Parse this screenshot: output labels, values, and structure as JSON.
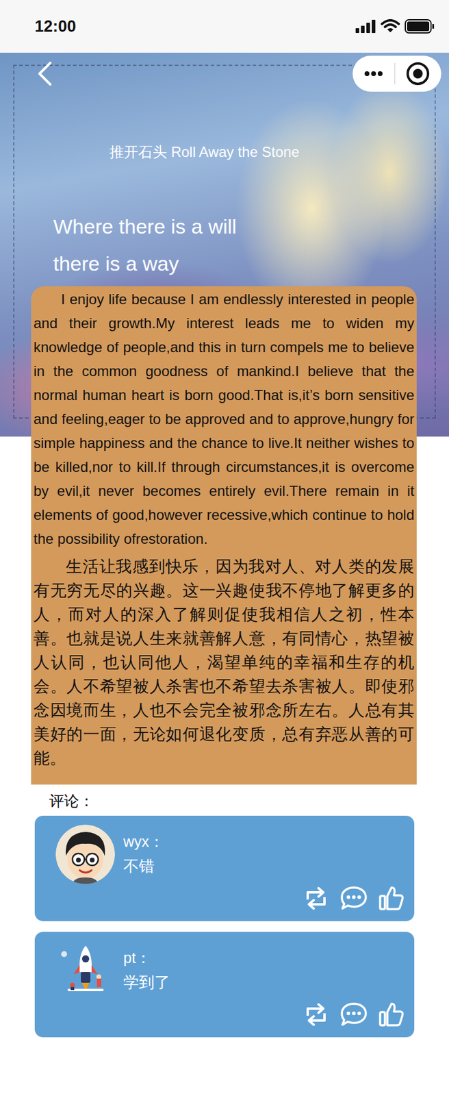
{
  "status_bar": {
    "time": "12:00"
  },
  "hero": {
    "subtitle": "推开石头 Roll Away the Stone",
    "slogan": [
      "Where there is a will",
      "there is a way"
    ]
  },
  "article": {
    "paragraphs": [
      {
        "lang": "en",
        "text": "I enjoy life because I am endlessly interested in people and their growth.My interest leads me to widen my knowledge of people,and this in turn compels me to believe in the common goodness of mankind.I believe that the normal human heart is born good.That is,it’s born sensitive and feeling,eager to be approved and to approve,hungry for simple happiness and the chance to live.It neither wishes to be killed,nor to kill.If through circumstances,it is overcome by evil,it never becomes entirely evil.There remain in it elements of good,however recessive,which continue to hold the possibility ofrestoration."
      },
      {
        "lang": "zh",
        "text": "生活让我感到快乐，因为我对人、对人类的发展有无穷无尽的兴趣。这一兴趣使我不停地了解更多的人，而对人的深入了解则促使我相信人之初，性本善。也就是说人生来就善解人意，有同情心，热望被人认同，也认同他人，渴望单纯的幸福和生存的机会。人不希望被人杀害也不希望去杀害被人。即使邪念因境而生，人也不会完全被邪念所左右。人总有其美好的一面，无论如何退化变质，总有弃恶从善的可能。"
      }
    ]
  },
  "comments": {
    "label": "评论：",
    "items": [
      {
        "user": "wyx：",
        "text": "不错",
        "kind": "boy"
      },
      {
        "user": "pt：",
        "text": "学到了",
        "kind": "rocket"
      }
    ]
  }
}
